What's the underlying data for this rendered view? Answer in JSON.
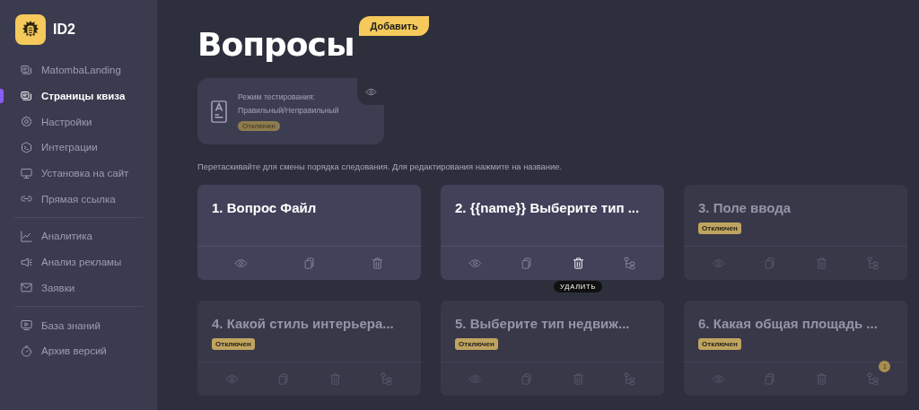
{
  "brand": {
    "name": "ID2"
  },
  "sidebar": {
    "groups": [
      [
        {
          "kind": "pages",
          "label": "MatombaLanding",
          "selected": false
        },
        {
          "kind": "pages",
          "label": "Страницы квиза",
          "selected": true
        },
        {
          "kind": "gear",
          "label": "Настройки",
          "selected": false
        },
        {
          "kind": "terminal",
          "label": "Интеграции",
          "selected": false
        },
        {
          "kind": "monitor",
          "label": "Установка на сайт",
          "selected": false
        },
        {
          "kind": "link",
          "label": "Прямая ссылка",
          "selected": false
        }
      ],
      [
        {
          "kind": "chart",
          "label": "Аналитика",
          "selected": false
        },
        {
          "kind": "megaphone",
          "label": "Анализ рекламы",
          "selected": false
        },
        {
          "kind": "mail",
          "label": "Заявки",
          "selected": false
        }
      ],
      [
        {
          "kind": "video",
          "label": "База знаний",
          "selected": false
        },
        {
          "kind": "timer",
          "label": "Архив версий",
          "selected": false
        }
      ]
    ]
  },
  "page": {
    "title": "Вопросы",
    "add_button": "Добавить"
  },
  "test_mode": {
    "line1": "Режим тестирования:",
    "line2": "Правильный/Неправильный",
    "status": "Отключен"
  },
  "hint": "Перетаскивайте для смены порядка следования. Для редактирования нажмите на название.",
  "questions": [
    {
      "title": "1. Вопрос Файл",
      "disabled": false,
      "actions": [
        {
          "kind": "preview",
          "highlighted": false
        },
        {
          "kind": "copy",
          "highlighted": false
        },
        {
          "kind": "delete",
          "highlighted": false
        }
      ]
    },
    {
      "title": "2. {{name}} Выберите тип ...",
      "disabled": false,
      "actions": [
        {
          "kind": "preview",
          "highlighted": false
        },
        {
          "kind": "copy",
          "highlighted": false
        },
        {
          "kind": "delete",
          "highlighted": true,
          "tooltip": "УДАЛИТЬ"
        },
        {
          "kind": "logic",
          "highlighted": false
        }
      ]
    },
    {
      "title": "3. Поле ввода",
      "disabled": true,
      "status": "Отключен",
      "actions": [
        {
          "kind": "preview",
          "highlighted": false
        },
        {
          "kind": "copy",
          "highlighted": false
        },
        {
          "kind": "delete",
          "highlighted": false
        },
        {
          "kind": "logic",
          "highlighted": false
        }
      ]
    },
    {
      "title": "4. Какой стиль интерьера...",
      "disabled": true,
      "status": "Отключен",
      "actions": [
        {
          "kind": "preview",
          "highlighted": false
        },
        {
          "kind": "copy",
          "highlighted": false
        },
        {
          "kind": "delete",
          "highlighted": false
        },
        {
          "kind": "logic",
          "highlighted": false
        }
      ]
    },
    {
      "title": "5. Выберите тип недвиж...",
      "disabled": true,
      "status": "Отключен",
      "actions": [
        {
          "kind": "preview",
          "highlighted": false
        },
        {
          "kind": "copy",
          "highlighted": false
        },
        {
          "kind": "delete",
          "highlighted": false
        },
        {
          "kind": "logic",
          "highlighted": false
        }
      ]
    },
    {
      "title": "6. Какая общая площадь ...",
      "disabled": true,
      "status": "Отключен",
      "actions": [
        {
          "kind": "preview",
          "highlighted": false
        },
        {
          "kind": "copy",
          "highlighted": false
        },
        {
          "kind": "delete",
          "highlighted": false
        },
        {
          "kind": "logic",
          "highlighted": false,
          "count": "1"
        }
      ]
    }
  ]
}
